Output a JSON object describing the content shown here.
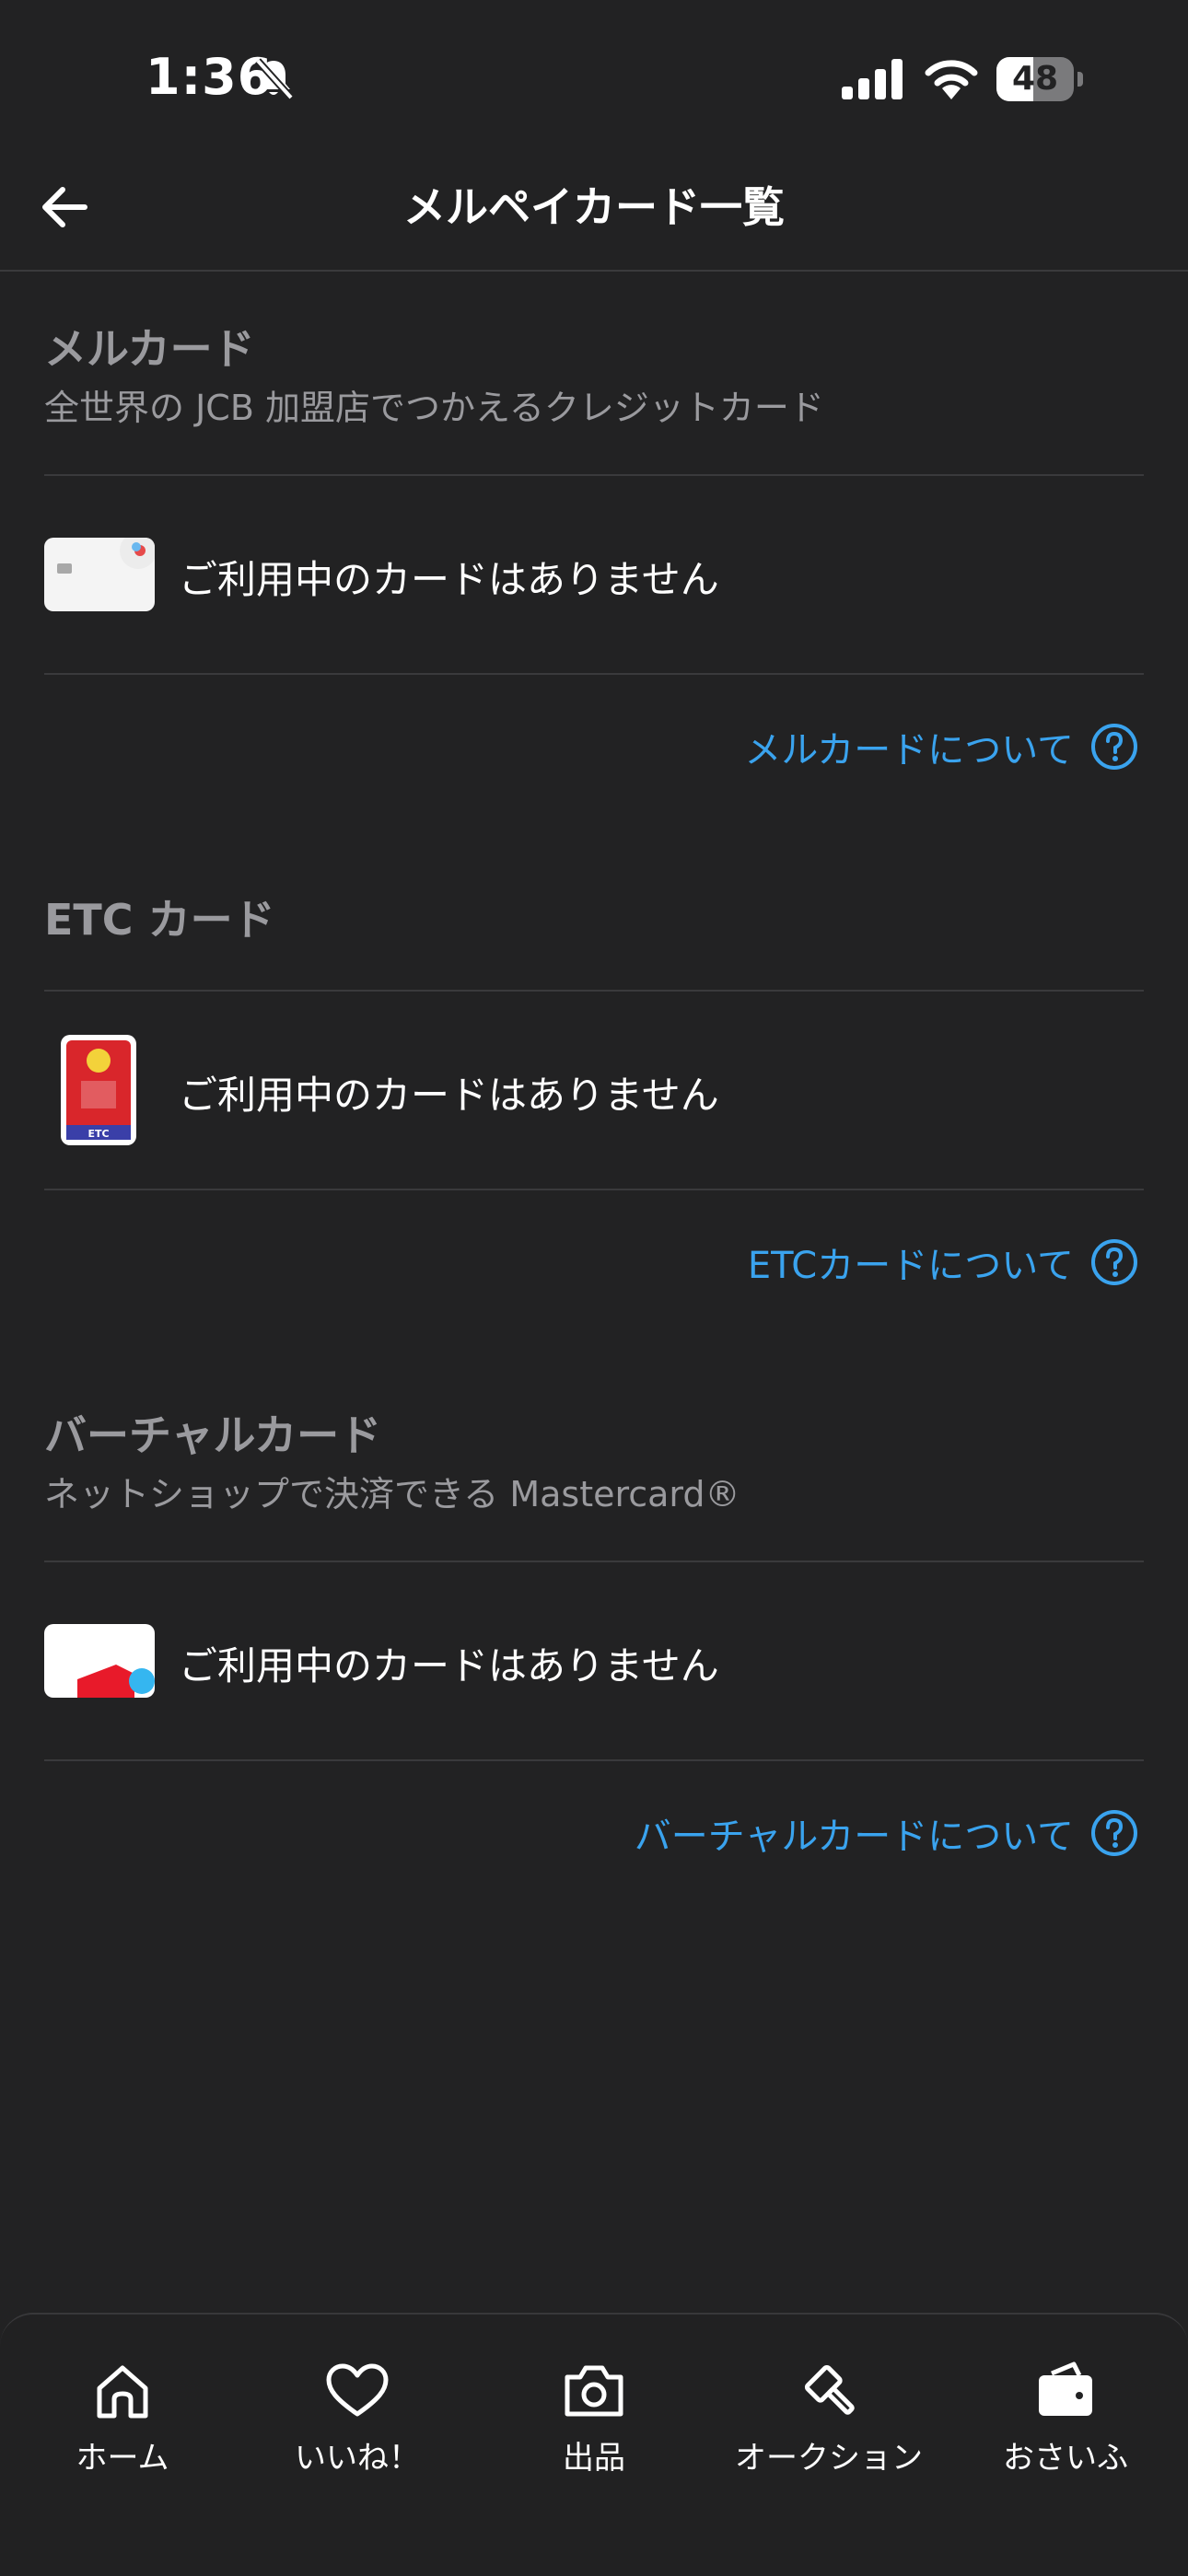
{
  "status": {
    "time": "1:36",
    "battery": "48",
    "battery_level": 0.48
  },
  "nav": {
    "title": "メルペイカード一覧"
  },
  "sections": {
    "merucard": {
      "title": "メルカード",
      "subtitle": "全世界の JCB 加盟店でつかえるクレジットカード",
      "empty_text": "ご利用中のカードはありません",
      "link": "メルカードについて"
    },
    "etc": {
      "title": "ETC カード",
      "empty_text": "ご利用中のカードはありません",
      "link": "ETCカードについて",
      "card_badge": "ETC"
    },
    "virtual": {
      "title": "バーチャルカード",
      "subtitle": "ネットショップで決済できる Mastercard®",
      "empty_text": "ご利用中のカードはありません",
      "link": "バーチャルカードについて"
    }
  },
  "tabbar": [
    {
      "label": "ホーム",
      "icon": "home-icon"
    },
    {
      "label": "いいね！",
      "icon": "heart-icon"
    },
    {
      "label": "出品",
      "icon": "camera-icon"
    },
    {
      "label": "オークション",
      "icon": "auction-hammer-icon"
    },
    {
      "label": "おさいふ",
      "icon": "wallet-icon"
    }
  ],
  "colors": {
    "background": "#222223",
    "link": "#3aa3ee",
    "muted_text": "#9a9a9e",
    "divider": "#3a3a3c"
  }
}
